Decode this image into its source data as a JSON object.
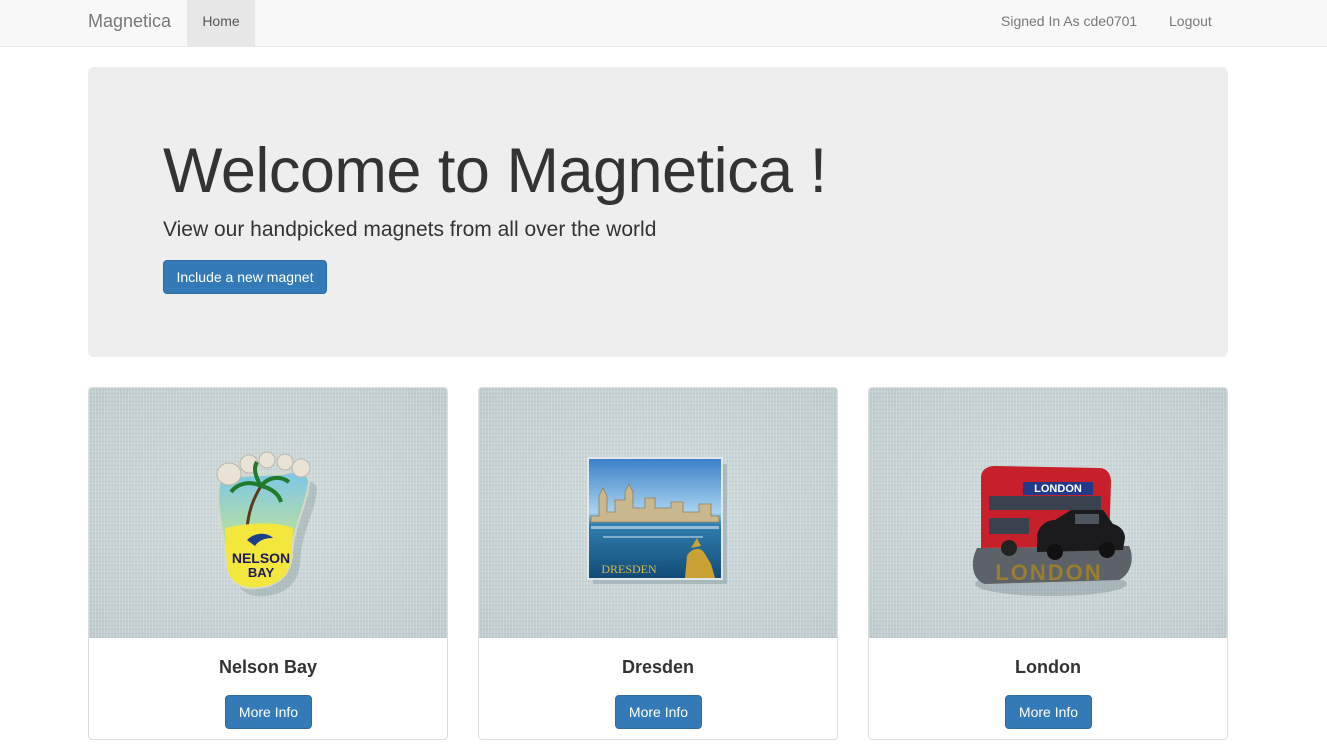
{
  "navbar": {
    "brand": "Magnetica",
    "home": "Home",
    "signed_in": "Signed In As cde0701",
    "logout": "Logout"
  },
  "jumbotron": {
    "title": "Welcome to Magnetica !",
    "subtitle": "View our handpicked magnets from all over the world",
    "button": "Include a new magnet"
  },
  "cards": [
    {
      "title": "Nelson Bay",
      "button": "More Info",
      "image_text": "NELSON BAY"
    },
    {
      "title": "Dresden",
      "button": "More Info",
      "image_text": "DRESDEN"
    },
    {
      "title": "London",
      "button": "More Info",
      "image_text": "LONDON"
    }
  ],
  "colors": {
    "primary": "#337ab7",
    "navbar_bg": "#f8f8f8",
    "jumbotron_bg": "#eeeeee"
  }
}
